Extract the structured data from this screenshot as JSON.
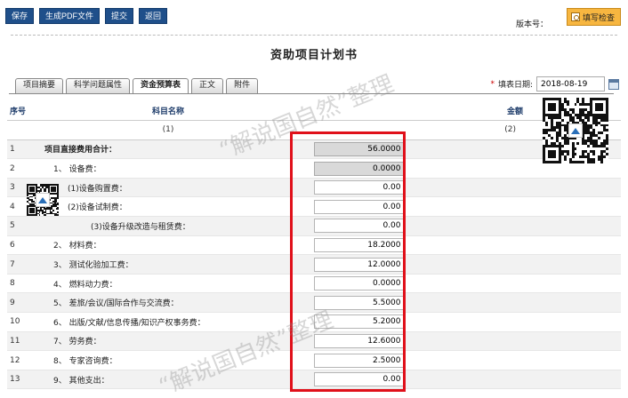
{
  "toolbar": {
    "save": "保存",
    "pdf": "生成PDF文件",
    "submit": "提交",
    "back": "返回"
  },
  "version_label": "版本号：",
  "check_label": "填写检查",
  "page_title": "资助项目计划书",
  "tabs": [
    {
      "label": "项目摘要",
      "active": false
    },
    {
      "label": "科学问题属性",
      "active": false
    },
    {
      "label": "资金预算表",
      "active": true
    },
    {
      "label": "正文",
      "active": false
    },
    {
      "label": "附件",
      "active": false
    }
  ],
  "date": {
    "required_mark": "*",
    "label": "填表日期:",
    "value": "2018-08-19"
  },
  "table": {
    "headers": [
      "序号",
      "科目名称",
      "金额"
    ],
    "subheaders": [
      "(1)",
      "(2)"
    ],
    "rows": [
      {
        "idx": "1",
        "name": "项目直接费用合计：",
        "amount": "56.0000",
        "level": 0,
        "readonly": true
      },
      {
        "idx": "2",
        "name": "1、 设备费：",
        "amount": "0.0000",
        "level": 1,
        "readonly": true
      },
      {
        "idx": "3",
        "name": "(1)设备购置费：",
        "amount": "0.00",
        "level": 2,
        "readonly": false
      },
      {
        "idx": "4",
        "name": "(2)设备试制费：",
        "amount": "0.00",
        "level": 2,
        "readonly": false
      },
      {
        "idx": "5",
        "name": "(3)设备升级改造与租赁费：",
        "amount": "0.00",
        "level": 3,
        "readonly": false
      },
      {
        "idx": "6",
        "name": "2、 材料费：",
        "amount": "18.2000",
        "level": 1,
        "readonly": false
      },
      {
        "idx": "7",
        "name": "3、 测试化验加工费：",
        "amount": "12.0000",
        "level": 1,
        "readonly": false
      },
      {
        "idx": "8",
        "name": "4、 燃料动力费：",
        "amount": "0.0000",
        "level": 1,
        "readonly": false
      },
      {
        "idx": "9",
        "name": "5、 差旅/会议/国际合作与交流费：",
        "amount": "5.5000",
        "level": 1,
        "readonly": false
      },
      {
        "idx": "10",
        "name": "6、 出版/文献/信息传播/知识产权事务费：",
        "amount": "5.2000",
        "level": 1,
        "readonly": false
      },
      {
        "idx": "11",
        "name": "7、 劳务费：",
        "amount": "12.6000",
        "level": 1,
        "readonly": false
      },
      {
        "idx": "12",
        "name": "8、 专家咨询费：",
        "amount": "2.5000",
        "level": 1,
        "readonly": false
      },
      {
        "idx": "13",
        "name": "9、 其他支出：",
        "amount": "0.00",
        "level": 1,
        "readonly": false
      }
    ]
  },
  "watermark": "“解说国自然”整理",
  "colors": {
    "toolbar_button": "#1f4f8a",
    "check_button": "#f7b640",
    "highlight_box": "#e0101a",
    "header_text": "#1f3d6b"
  }
}
